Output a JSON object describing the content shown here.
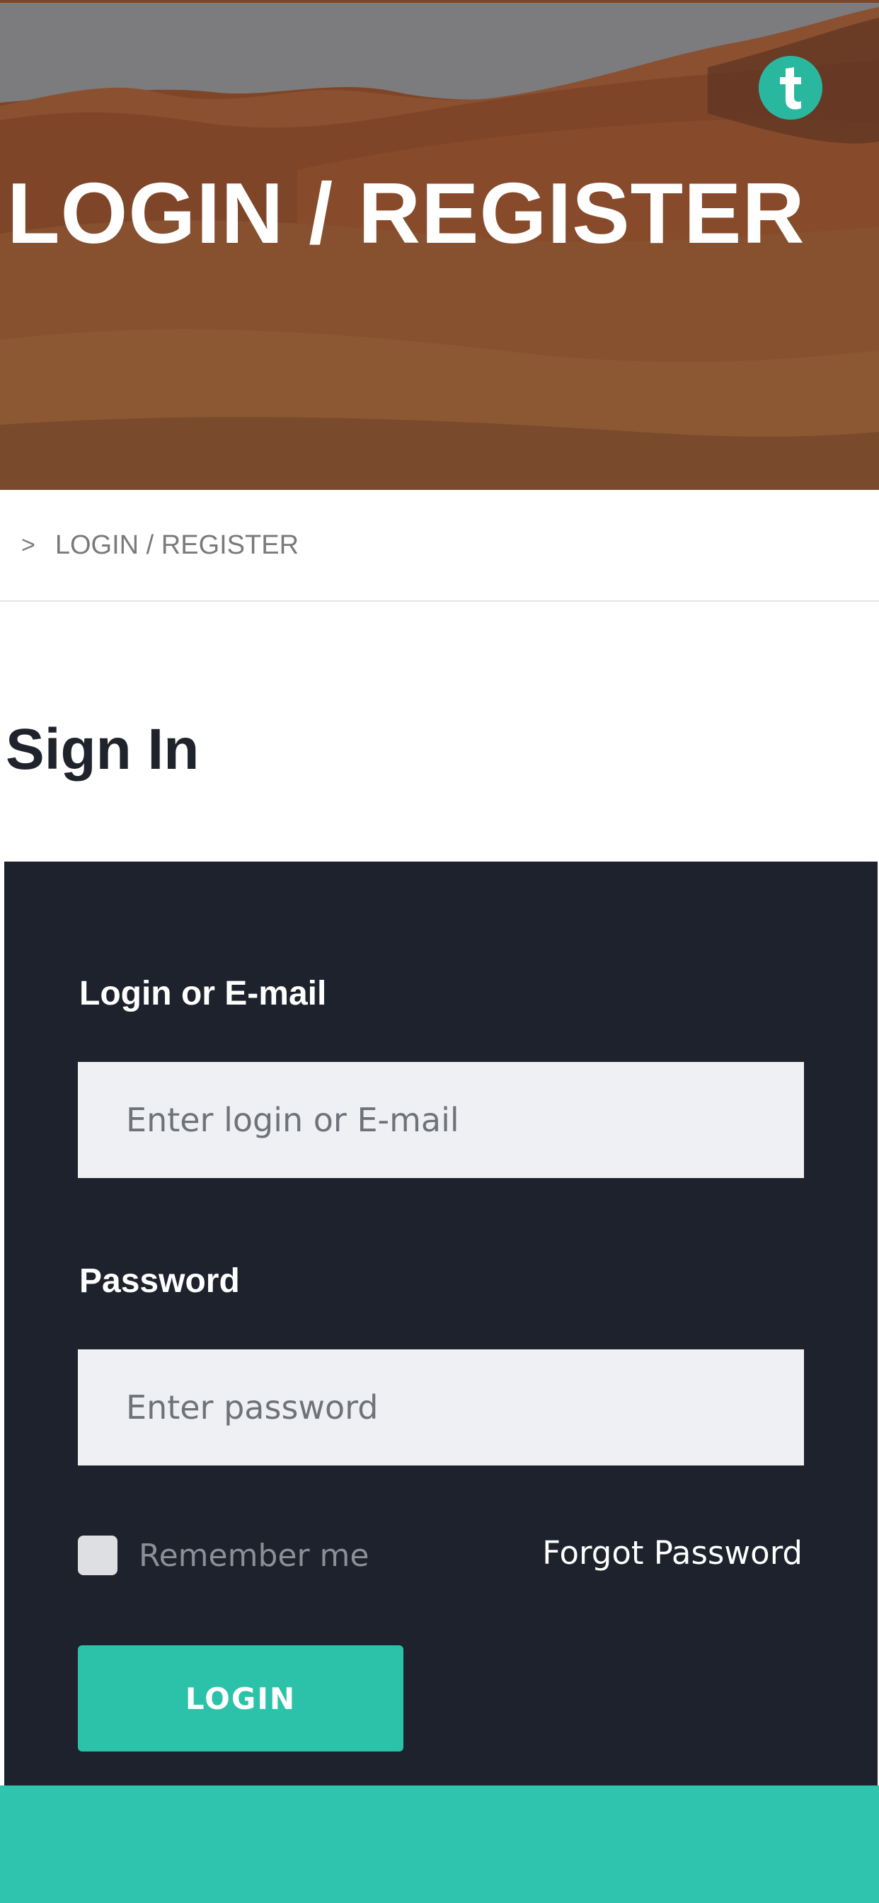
{
  "hero": {
    "title": "LOGIN / REGISTER",
    "brand_logo_letter": "t",
    "brand_color": "#2ab7a0"
  },
  "breadcrumb": {
    "separator": ">",
    "current": "LOGIN / REGISTER"
  },
  "signin": {
    "title": "Sign In"
  },
  "form": {
    "login_label": "Login or E-mail",
    "login_placeholder": "Enter login or E-mail",
    "login_value": "",
    "password_label": "Password",
    "password_placeholder": "Enter password",
    "password_value": "",
    "remember_label": "Remember me",
    "remember_checked": false,
    "forgot_label": "Forgot Password",
    "login_button": "LOGIN"
  },
  "colors": {
    "accent": "#2cc2a9",
    "panel_bg": "#1d222c",
    "input_bg": "#eff0f3"
  }
}
